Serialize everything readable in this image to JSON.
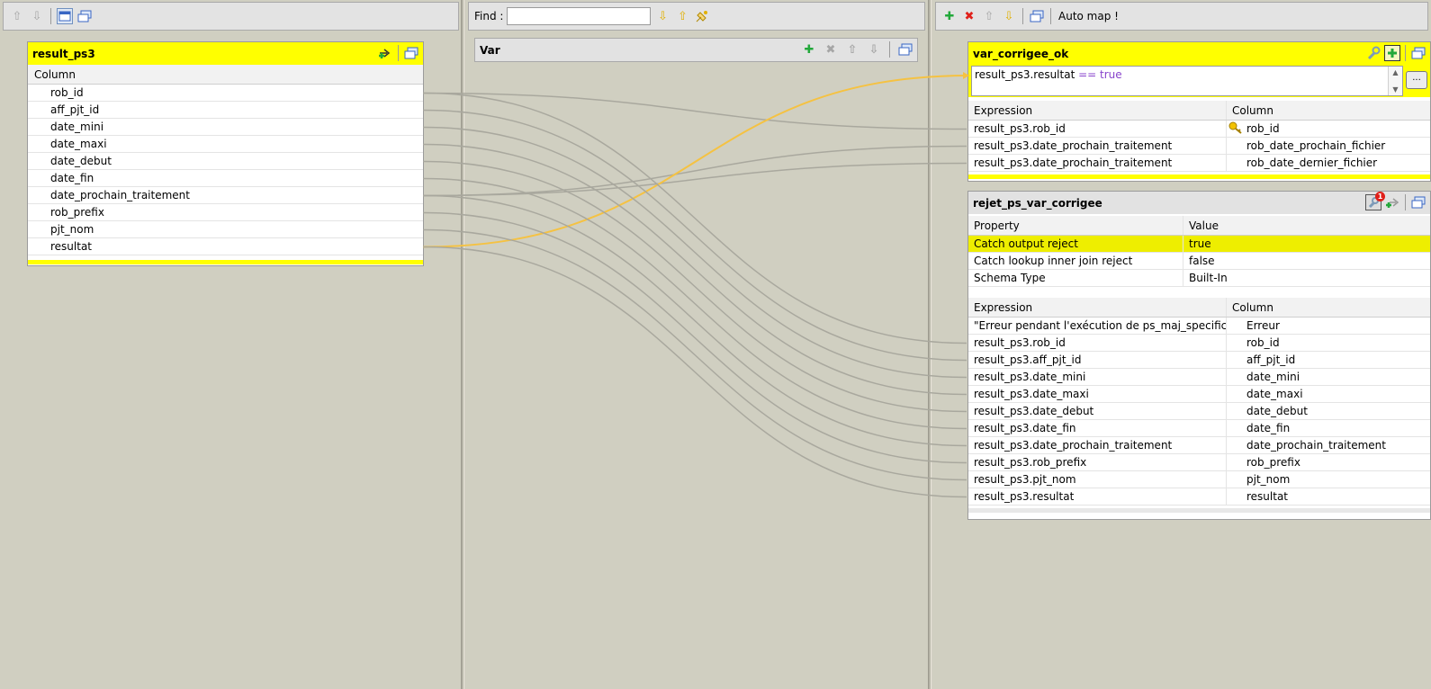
{
  "left_toolbar": {
    "icons": [
      "move-up-icon",
      "move-down-icon",
      "minimize-icon",
      "tile-icon"
    ]
  },
  "mid_toolbar": {
    "find_label": "Find :",
    "find_value": "",
    "icons": [
      "next-icon",
      "previous-icon",
      "highlight-icon"
    ]
  },
  "right_toolbar": {
    "automap_label": "Auto map !",
    "icons": [
      "add-icon",
      "remove-icon",
      "move-up-icon",
      "move-down-icon",
      "tile-icon"
    ]
  },
  "input_table": {
    "title": "result_ps3",
    "column_header": "Column",
    "rows": [
      "rob_id",
      "aff_pjt_id",
      "date_mini",
      "date_maxi",
      "date_debut",
      "date_fin",
      "date_prochain_traitement",
      "rob_prefix",
      "pjt_nom",
      "resultat"
    ]
  },
  "var_table": {
    "title": "Var"
  },
  "output_ok": {
    "title": "var_corrigee_ok",
    "filter_field": "result_ps3.resultat",
    "filter_operator": "==",
    "filter_value": "true",
    "headers": {
      "expression": "Expression",
      "column": "Column"
    },
    "rows": [
      {
        "expression": "result_ps3.rob_id",
        "column": "rob_id",
        "key": true
      },
      {
        "expression": "result_ps3.date_prochain_traitement",
        "column": "rob_date_prochain_fichier",
        "key": false
      },
      {
        "expression": "result_ps3.date_prochain_traitement",
        "column": "rob_date_dernier_fichier",
        "key": false
      }
    ]
  },
  "output_reject": {
    "title": "rejet_ps_var_corrigee",
    "badge": "1",
    "prop_headers": {
      "property": "Property",
      "value": "Value"
    },
    "properties": [
      {
        "property": "Catch output reject",
        "value": "true",
        "selected": true
      },
      {
        "property": "Catch lookup inner join reject",
        "value": "false",
        "selected": false
      },
      {
        "property": "Schema Type",
        "value": "Built-In",
        "selected": false
      }
    ],
    "headers": {
      "expression": "Expression",
      "column": "Column"
    },
    "rows": [
      {
        "expression": "\"Erreur pendant l'exécution de ps_maj_specificite\"",
        "column": "Erreur"
      },
      {
        "expression": "result_ps3.rob_id",
        "column": "rob_id"
      },
      {
        "expression": "result_ps3.aff_pjt_id",
        "column": "aff_pjt_id"
      },
      {
        "expression": "result_ps3.date_mini",
        "column": "date_mini"
      },
      {
        "expression": "result_ps3.date_maxi",
        "column": "date_maxi"
      },
      {
        "expression": "result_ps3.date_debut",
        "column": "date_debut"
      },
      {
        "expression": "result_ps3.date_fin",
        "column": "date_fin"
      },
      {
        "expression": "result_ps3.date_prochain_traitement",
        "column": "date_prochain_traitement"
      },
      {
        "expression": "result_ps3.rob_prefix",
        "column": "rob_prefix"
      },
      {
        "expression": "result_ps3.pjt_nom",
        "column": "pjt_nom"
      },
      {
        "expression": "result_ps3.resultat",
        "column": "resultat"
      }
    ]
  },
  "links": [
    {
      "from": 0,
      "to": "ok",
      "row": 0,
      "color": "#a9a89e"
    },
    {
      "from": 6,
      "to": "ok",
      "row": 1,
      "color": "#a9a89e"
    },
    {
      "from": 6,
      "to": "ok",
      "row": 2,
      "color": "#a9a89e"
    },
    {
      "from": 9,
      "to": "filter",
      "row": 0,
      "color": "#f5c242"
    },
    {
      "from": 0,
      "to": "rej",
      "row": 1,
      "color": "#a9a89e"
    },
    {
      "from": 1,
      "to": "rej",
      "row": 2,
      "color": "#a9a89e"
    },
    {
      "from": 2,
      "to": "rej",
      "row": 3,
      "color": "#a9a89e"
    },
    {
      "from": 3,
      "to": "rej",
      "row": 4,
      "color": "#a9a89e"
    },
    {
      "from": 4,
      "to": "rej",
      "row": 5,
      "color": "#a9a89e"
    },
    {
      "from": 5,
      "to": "rej",
      "row": 6,
      "color": "#a9a89e"
    },
    {
      "from": 6,
      "to": "rej",
      "row": 7,
      "color": "#a9a89e"
    },
    {
      "from": 7,
      "to": "rej",
      "row": 8,
      "color": "#a9a89e"
    },
    {
      "from": 8,
      "to": "rej",
      "row": 9,
      "color": "#a9a89e"
    },
    {
      "from": 9,
      "to": "rej",
      "row": 10,
      "color": "#a9a89e"
    }
  ]
}
